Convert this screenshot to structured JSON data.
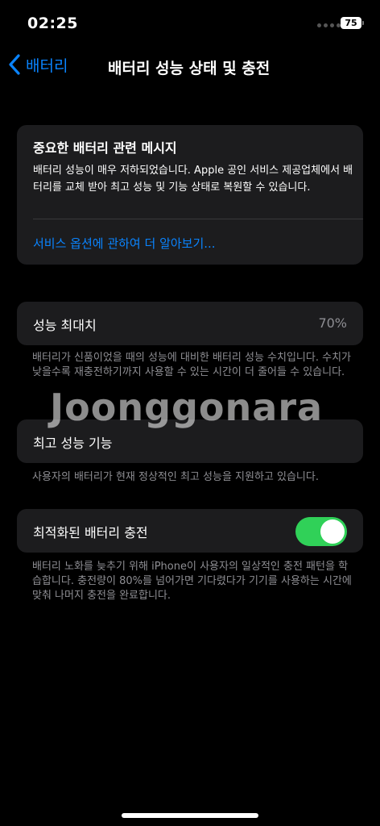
{
  "status_bar": {
    "time": "02:25",
    "battery_level": "75"
  },
  "nav": {
    "back_label": "배터리",
    "title": "배터리 성능 상태 및 충전"
  },
  "message_card": {
    "title": "중요한 배터리 관련 메시지",
    "body": "배터리 성능이 매우 저하되었습니다. Apple 공인 서비스 제공업체에서 배터리를 교체 받아 최고 성능 및 기능 상태로 복원할 수 있습니다.",
    "link": "서비스 옵션에 관하여 더 알아보기..."
  },
  "peak_capacity": {
    "label": "성능 최대치",
    "value": "70%",
    "footnote": "배터리가 신품이었을 때의 성능에 대비한 배터리 성능 수치입니다. 수치가 낮을수록 재충전하기까지 사용할 수 있는 시간이 더 줄어들 수 있습니다."
  },
  "peak_performance": {
    "label": "최고 성능 기능",
    "footnote": "사용자의 배터리가 현재 정상적인 최고 성능을 지원하고 있습니다."
  },
  "optimized_charging": {
    "label": "최적화된 배터리 충전",
    "enabled": true,
    "footnote": "배터리 노화를 늦추기 위해 iPhone이 사용자의 일상적인 충전 패턴을 학습합니다. 충전량이 80%를 넘어가면 기다렸다가 기기를 사용하는 시간에 맞춰 나머지 충전을 완료합니다."
  },
  "watermark": "Joonggonara",
  "colors": {
    "accent": "#0a84ff",
    "toggle_on": "#30d158",
    "card_bg": "#1c1c1e",
    "secondary_text": "#8e8e93"
  }
}
